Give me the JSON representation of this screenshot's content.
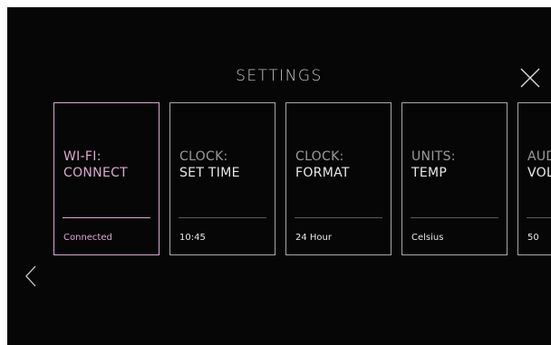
{
  "header": {
    "title": "SETTINGS"
  },
  "icons": {
    "close": "close-icon",
    "previous": "chevron-left-icon"
  },
  "colors": {
    "background": "#060606",
    "selected_accent": "#d9a8d2",
    "card_border": "#a8a8a8",
    "text": "#e8e8e8"
  },
  "cards": [
    {
      "title": "WI-FI:",
      "subtitle": "CONNECT",
      "value": "Connected",
      "selected": true
    },
    {
      "title": "CLOCK:",
      "subtitle": "SET TIME",
      "value": "10:45",
      "selected": false
    },
    {
      "title": "CLOCK:",
      "subtitle": "FORMAT",
      "value": "24 Hour",
      "selected": false
    },
    {
      "title": "UNITS:",
      "subtitle": "TEMP",
      "value": "Celsius",
      "selected": false
    },
    {
      "title": "AUD",
      "subtitle": "VOL",
      "value": "50",
      "selected": false
    }
  ]
}
